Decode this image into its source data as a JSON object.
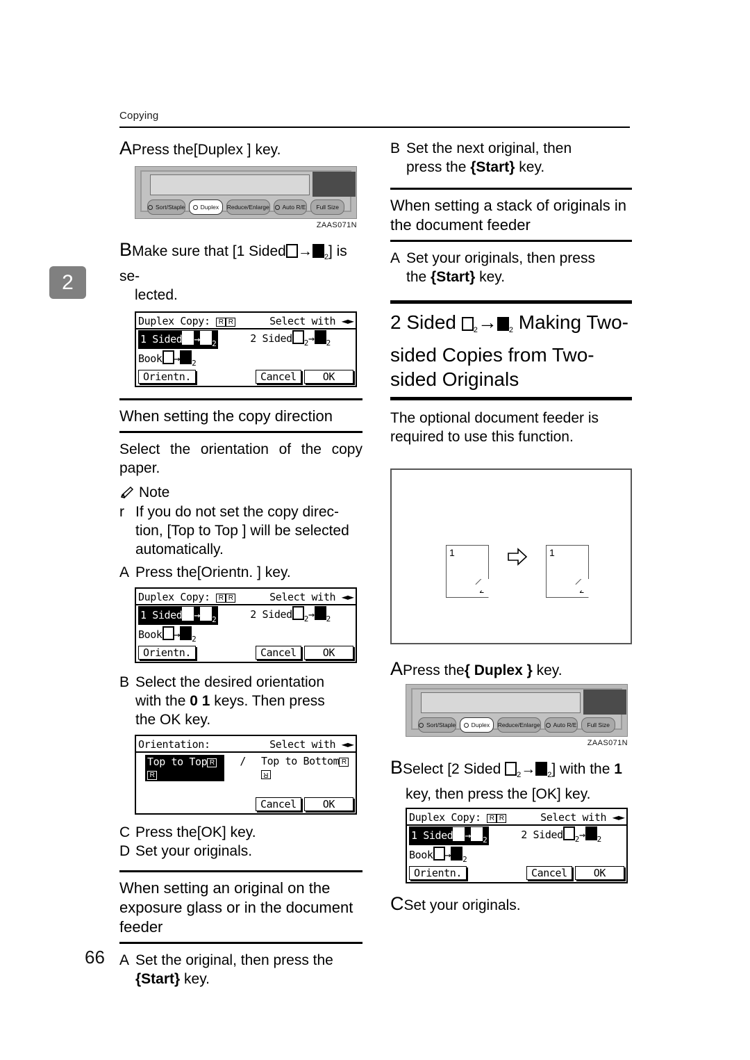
{
  "running_head": "Copying",
  "chapter_tab": "2",
  "page_number": "66",
  "photo_id": "ZAAS071N",
  "left_column": {
    "step_a_label": "A",
    "step_a_text_pre": "Press the",
    "step_a_key": "[Duplex ]",
    "step_a_text_post": "key.",
    "step_b_label": "B",
    "step_b_text": "Make sure that [1 Sided □→□₂] is selected.",
    "step_b_text_1": "Make sure that",
    "step_b_bracket_open": "[1 Sided",
    "step_b_bracket_close": "] is se-",
    "step_b_line2": "lected.",
    "subhead_copy_direction": "When setting the copy direction",
    "copy_direction_para": "Select the orientation of the copy paper.",
    "note_label": "Note",
    "note_bullet_char": "r",
    "note_bullet_text_1": "If you do not set the copy direc-",
    "note_bullet_text_2": "tion, [Top to Top ] will be selected",
    "note_bullet_text_3": "automatically.",
    "note_step_a_label": "A",
    "note_step_a_pre": "Press the",
    "note_step_a_key": "[Orientn. ]",
    "note_step_a_post": "key.",
    "note_step_b_label": "B",
    "note_step_b_line1": "Select the desired orientation",
    "note_step_b_line2_pre": "with the",
    "note_step_b_keys": "0 1",
    "note_step_b_line2_post": "keys. Then press",
    "note_step_b_line3": "the OK key.",
    "step_c_label": "C",
    "step_c_pre": "Press the",
    "step_c_key": "[OK]",
    "step_c_post": "key.",
    "step_d_label": "D",
    "step_d_text": "Set your originals.",
    "subhead_exposure": "When setting an original on the exposure glass or in the document feeder",
    "exposure_step_a_label": "A",
    "exposure_step_a_line1": "Set the original, then press the",
    "exposure_step_a_key": "{Start}",
    "exposure_step_a_post": "key."
  },
  "right_column": {
    "step_b_label": "B",
    "step_b_line1": "Set the next original, then",
    "step_b_line2_pre": "press the",
    "step_b_key": "{Start}",
    "step_b_line2_post": "key.",
    "subhead_stack": "When setting a stack of originals in the document feeder",
    "stack_step_a_label": "A",
    "stack_step_a_line1": "Set your originals, then press",
    "stack_step_a_line2_pre": "the",
    "stack_step_a_key": "{Start}",
    "stack_step_a_line2_post": "key.",
    "section_title_pre": "2 Sided",
    "section_title_post": "Making Two-sided Copies from Two-sided Originals",
    "section_intro": "The optional document feeder is required to use this function.",
    "illustration": {
      "source_page_front": "1",
      "source_page_back": "2",
      "result_page_front": "1",
      "result_page_back": "2"
    },
    "step_a_label": "A",
    "step_a_pre": "Press the",
    "step_a_key": "{ Duplex }",
    "step_a_post": "key.",
    "final_step_b_label": "B",
    "final_step_b_line1_pre": "Select [2 Sided",
    "final_step_b_line1_post": "] with the",
    "final_step_b_keynum": "1",
    "final_step_b_line2": "key, then press the [OK] key.",
    "final_step_c_label": "C",
    "final_step_c_text": "Set your originals."
  },
  "control_panel": {
    "buttons": [
      {
        "label": "Sort/Staple",
        "led": true,
        "highlight": false
      },
      {
        "label": "Duplex",
        "led": true,
        "highlight": true
      },
      {
        "label": "Reduce/Enlarge",
        "led": false,
        "highlight": false
      },
      {
        "label": "Auto R/E",
        "led": true,
        "highlight": false
      },
      {
        "label": "Full Size",
        "led": false,
        "highlight": false
      }
    ]
  },
  "lcd_duplex": {
    "title": "Duplex Copy:",
    "hint": "Select with",
    "option_selected": "1 Sided",
    "option_2sided": "2 Sided",
    "option_book": "Book",
    "btn_orientn": "Orientn.",
    "btn_cancel": "Cancel",
    "btn_ok": "OK"
  },
  "lcd_orientation": {
    "title": "Orientation:",
    "hint": "Select with",
    "option_selected": "Top to Top",
    "separator": "/",
    "option_other": "Top to Bottom",
    "btn_cancel": "Cancel",
    "btn_ok": "OK"
  }
}
